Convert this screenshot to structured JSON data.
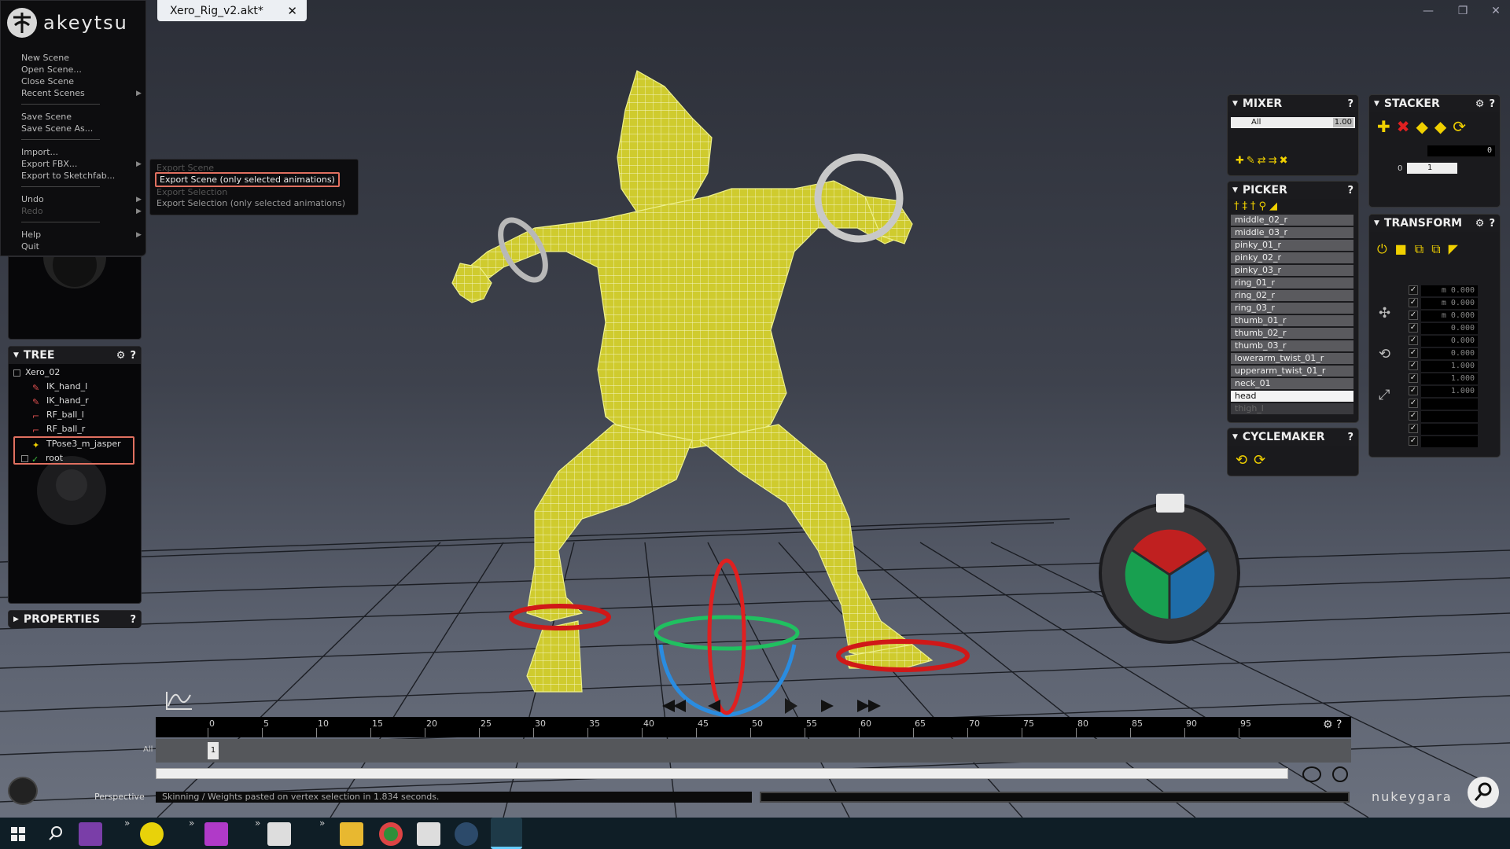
{
  "window": {
    "tab_title": "Xero_Rig_v2.akt*",
    "tab_close": "✕",
    "minimize": "—",
    "restore": "❐",
    "close": "✕"
  },
  "menu": {
    "brand": "akeytsu",
    "items": [
      "New Scene",
      "Open Scene...",
      "Close Scene",
      "Recent Scenes",
      "Save Scene",
      "Save Scene As...",
      "Import...",
      "Export FBX...",
      "Export to Sketchfab...",
      "Undo",
      "Redo",
      "Help",
      "Quit"
    ],
    "submenu": [
      "Export Scene",
      "Export Scene (only selected animations)",
      "Export Selection",
      "Export Selection (only selected animations)"
    ]
  },
  "tree": {
    "title": "TREE",
    "items": [
      "Xero_02",
      "IK_hand_l",
      "IK_hand_r",
      "RF_ball_l",
      "RF_ball_r",
      "TPose3_m_jasper",
      "root"
    ]
  },
  "properties": {
    "title": "PROPERTIES"
  },
  "mixer": {
    "title": "MIXER",
    "layer": "All",
    "weight": "1.00"
  },
  "stacker": {
    "title": "STACKER",
    "value": "0",
    "index": "0",
    "layer": "1"
  },
  "picker": {
    "title": "PICKER",
    "items": [
      "middle_02_r",
      "middle_03_r",
      "pinky_01_r",
      "pinky_02_r",
      "pinky_03_r",
      "ring_01_r",
      "ring_02_r",
      "ring_03_r",
      "thumb_01_r",
      "thumb_02_r",
      "thumb_03_r",
      "lowerarm_twist_01_r",
      "upperarm_twist_01_r",
      "neck_01",
      "head",
      "thigh_l"
    ],
    "selected": "head"
  },
  "transform": {
    "title": "TRANSFORM",
    "values": [
      "m 0.000",
      "m 0.000",
      "m 0.000",
      "0.000",
      "0.000",
      "0.000",
      "1.000",
      "1.000",
      "1.000",
      "",
      "",
      "",
      ""
    ]
  },
  "cyclemaker": {
    "title": "CYCLEMAKER"
  },
  "timeline": {
    "ticks": [
      "0",
      "5",
      "10",
      "15",
      "20",
      "25",
      "30",
      "35",
      "40",
      "45",
      "50",
      "55",
      "60",
      "65",
      "70",
      "75",
      "80",
      "85",
      "90",
      "95"
    ],
    "track_label": "All",
    "current_frame": "1"
  },
  "viewport": {
    "camera": "Perspective"
  },
  "status": {
    "message": "Skinning / Weights pasted on vertex selection in 1.834 seconds."
  },
  "branding": {
    "company": "nukeygara"
  },
  "help_glyph": "?",
  "gear_glyph": "⚙",
  "colors": {
    "mesh": "#d6d233",
    "wire": "#f4f6c0",
    "accent": "#e07060",
    "gizmo_red": "#e02020",
    "gizmo_green": "#20c060",
    "gizmo_blue": "#2a8ce0"
  }
}
